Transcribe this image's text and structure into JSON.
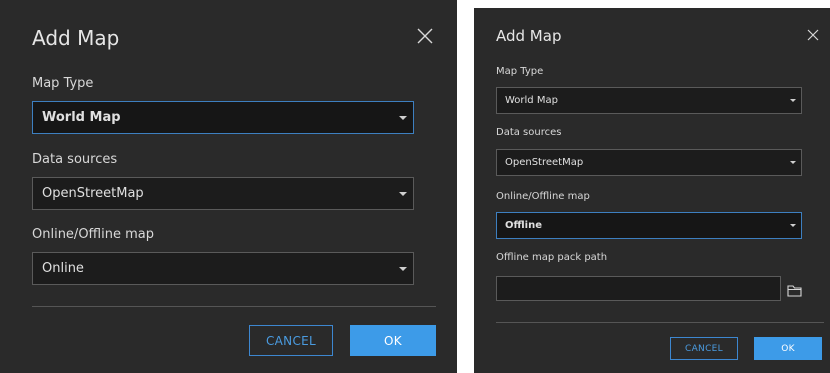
{
  "colors": {
    "dialog_bg": "#2a2a2a",
    "field_bg": "#1c1c1c",
    "focus_border": "#3d7fc0",
    "primary_button": "#3d9be8",
    "cancel_text": "#4a9be0"
  },
  "dialog_online": {
    "title": "Add Map",
    "close_icon": "close-icon",
    "map_type": {
      "label": "Map Type",
      "value": "World Map"
    },
    "data_sources": {
      "label": "Data sources",
      "value": "OpenStreetMap"
    },
    "online_offline": {
      "label": "Online/Offline map",
      "value": "Online"
    },
    "cancel_label": "CANCEL",
    "ok_label": "OK"
  },
  "dialog_offline": {
    "title": "Add Map",
    "close_icon": "close-icon",
    "map_type": {
      "label": "Map Type",
      "value": "World Map"
    },
    "data_sources": {
      "label": "Data sources",
      "value": "OpenStreetMap"
    },
    "online_offline": {
      "label": "Online/Offline map",
      "value": "Offline"
    },
    "offline_path": {
      "label": "Offline map pack path",
      "value": "",
      "icon": "folder-icon"
    },
    "cancel_label": "CANCEL",
    "ok_label": "OK"
  }
}
